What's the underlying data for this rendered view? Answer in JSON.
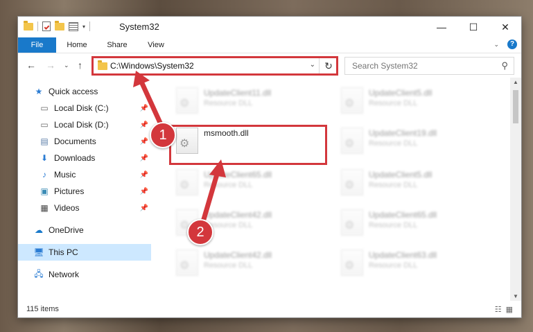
{
  "window": {
    "title": "System32"
  },
  "ribbon": {
    "tabs": [
      "File",
      "Home",
      "Share",
      "View"
    ]
  },
  "address": {
    "path": "C:\\Windows\\System32"
  },
  "search": {
    "placeholder": "Search System32"
  },
  "nav": {
    "items": [
      {
        "label": "Quick access",
        "icon": "star-icon",
        "pinned": false
      },
      {
        "label": "Local Disk (C:)",
        "icon": "drive-icon",
        "pinned": true
      },
      {
        "label": "Local Disk (D:)",
        "icon": "drive-icon",
        "pinned": true
      },
      {
        "label": "Documents",
        "icon": "document-icon",
        "pinned": true
      },
      {
        "label": "Downloads",
        "icon": "download-icon",
        "pinned": true
      },
      {
        "label": "Music",
        "icon": "music-icon",
        "pinned": true
      },
      {
        "label": "Pictures",
        "icon": "picture-icon",
        "pinned": true
      },
      {
        "label": "Videos",
        "icon": "video-icon",
        "pinned": true
      },
      {
        "label": "OneDrive",
        "icon": "cloud-icon",
        "pinned": false
      },
      {
        "label": "This PC",
        "icon": "computer-icon",
        "pinned": false,
        "selected": true
      },
      {
        "label": "Network",
        "icon": "network-icon",
        "pinned": false
      }
    ]
  },
  "files": {
    "left": [
      {
        "name": "UpdateClient11.dll",
        "type": "Resource DLL"
      },
      {
        "name": "msmooth.dll",
        "type": ""
      },
      {
        "name": "UpdateClient65.dll",
        "type": "Resource DLL"
      },
      {
        "name": "UpdateClient42.dll",
        "type": "Resource DLL"
      },
      {
        "name": "UpdateClient42.dll",
        "type": "Resource DLL"
      }
    ],
    "right": [
      {
        "name": "UpdateClient5.dll",
        "type": "Resource DLL"
      },
      {
        "name": "UpdateClient19.dll",
        "type": "Resource DLL"
      },
      {
        "name": "UpdateClient5.dll",
        "type": "Resource DLL"
      },
      {
        "name": "UpdateClient65.dll",
        "type": "Resource DLL"
      },
      {
        "name": "UpdateClient63.dll",
        "type": "Resource DLL"
      }
    ]
  },
  "annotations": {
    "step1": "1",
    "step2": "2"
  },
  "status": {
    "count": "115 items"
  },
  "colors": {
    "accent": "#1979ca",
    "highlight": "#d3373c",
    "selection": "#cde8ff"
  }
}
